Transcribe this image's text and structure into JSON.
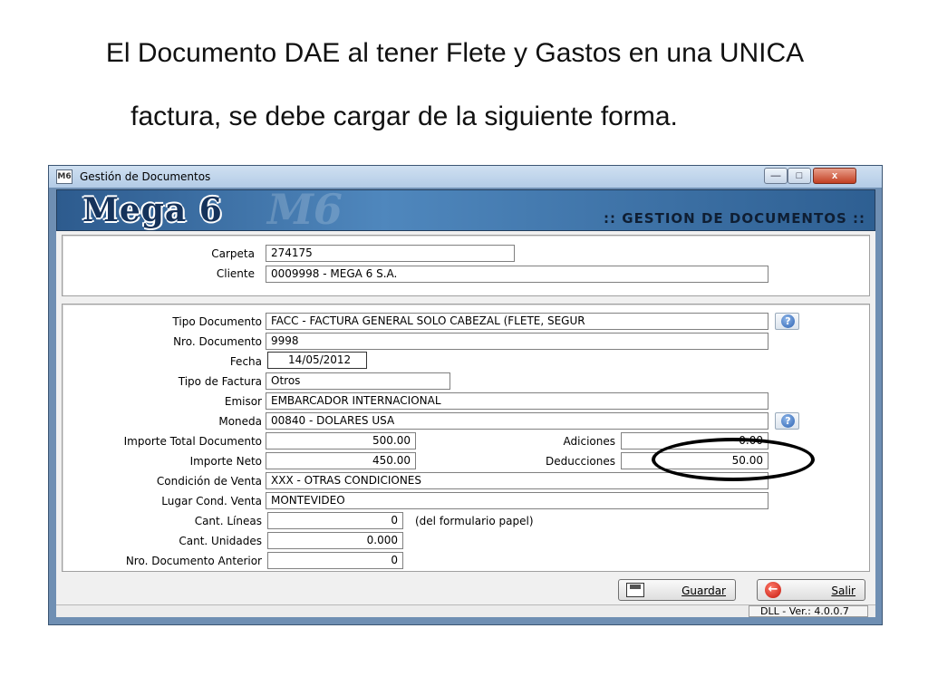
{
  "slide": {
    "title_line1": "El Documento DAE al tener Flete y Gastos en una UNICA",
    "title_line2": "factura, se debe cargar de la siguiente forma."
  },
  "window": {
    "title": "Gestión de Documentos",
    "app_icon": "M6",
    "controls": {
      "minimize": "—",
      "maximize": "□",
      "close": "x"
    }
  },
  "banner": {
    "logo": "Mega 6",
    "watermark": "M6",
    "heading": ":: GESTION DE DOCUMENTOS ::"
  },
  "header_fields": {
    "carpeta": {
      "label": "Carpeta",
      "value": "274175"
    },
    "cliente": {
      "label": "Cliente",
      "value": "0009998 - MEGA 6 S.A."
    }
  },
  "form": {
    "tipo_documento": {
      "label": "Tipo Documento",
      "value": "FACC  - FACTURA GENERAL SOLO CABEZAL (FLETE, SEGUR"
    },
    "nro_documento": {
      "label": "Nro. Documento",
      "value": "9998"
    },
    "fecha": {
      "label": "Fecha",
      "value": "14/05/2012"
    },
    "tipo_factura": {
      "label": "Tipo de Factura",
      "value": "Otros"
    },
    "emisor": {
      "label": "Emisor",
      "value": "EMBARCADOR INTERNACIONAL"
    },
    "moneda": {
      "label": "Moneda",
      "value": "00840 - DOLARES USA"
    },
    "importe_total": {
      "label": "Importe Total Documento",
      "value": "500.00"
    },
    "adiciones": {
      "label": "Adiciones",
      "value": "0.00"
    },
    "importe_neto": {
      "label": "Importe Neto",
      "value": "450.00"
    },
    "deducciones": {
      "label": "Deducciones",
      "value": "50.00"
    },
    "condicion_venta": {
      "label": "Condición de Venta",
      "value": "XXX - OTRAS CONDICIONES"
    },
    "lugar_cond_venta": {
      "label": "Lugar Cond. Venta",
      "value": "MONTEVIDEO"
    },
    "cant_lineas": {
      "label": "Cant. Líneas",
      "value": "0",
      "note": "(del formulario papel)"
    },
    "cant_unidades": {
      "label": "Cant. Unidades",
      "value": "0.000"
    },
    "nro_doc_anterior": {
      "label": "Nro. Documento Anterior",
      "value": "0"
    }
  },
  "icons": {
    "help": "?",
    "exit": "←"
  },
  "actions": {
    "save": "Guardar",
    "exit": "Salir"
  },
  "status": {
    "version": "DLL - Ver.: 4.0.0.7"
  }
}
